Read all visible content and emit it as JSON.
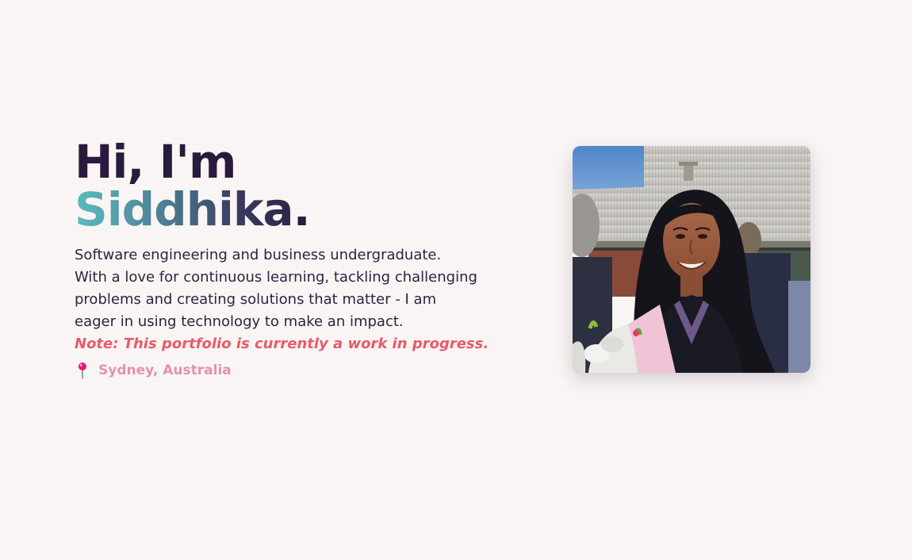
{
  "hero": {
    "greeting": "Hi, I'm",
    "name": "Siddhika",
    "name_suffix": ".",
    "bio_lines": [
      "Software engineering and business undergraduate.",
      "With a love for continuous learning, tackling challenging",
      "problems and creating solutions that matter - I am",
      "eager in using technology to make an impact."
    ],
    "note": "Note: This portfolio is currently a work in progress.",
    "location": "Sydney, Australia",
    "location_icon": "pin-icon"
  },
  "photo": {
    "icon": "profile-photo"
  },
  "colors": {
    "background": "#f9f5f4",
    "heading": "#2a1a3d",
    "name_gradient_start": "#5bbcc0",
    "name_gradient_end": "#2e2647",
    "note": "#e85a6a",
    "location": "#e391b3"
  }
}
